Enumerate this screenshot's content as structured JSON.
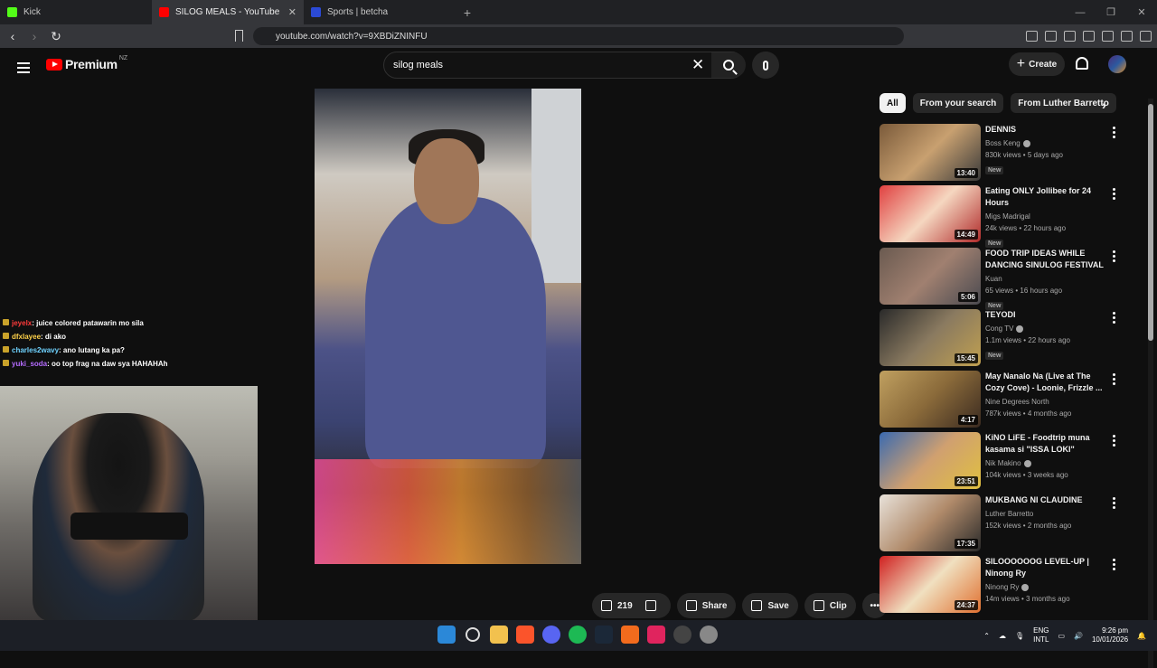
{
  "browser": {
    "tabs": [
      {
        "title": "Kick",
        "color": "#53fc18"
      },
      {
        "title": "SILOG MEALS - YouTube",
        "color": "#ff0000"
      },
      {
        "title": "Sports | betcha",
        "color": "#2b4ad6"
      }
    ],
    "url": "youtube.com/watch?v=9XBDiZNINFU"
  },
  "youtube": {
    "logo_text": "Premium",
    "region": "NZ",
    "search_query": "silog meals",
    "create_label": "Create",
    "filter_chips": [
      "All",
      "From your search",
      "From Luther Barretto"
    ],
    "actions": {
      "likes": "219",
      "share": "Share",
      "save": "Save",
      "clip": "Clip"
    },
    "recommendations": [
      {
        "title": "DENNIS",
        "channel": "Boss Keng",
        "verified": true,
        "meta": "830k views • 5 days ago",
        "badge": "New",
        "duration": "13:40",
        "thumb": [
          "#7a5a3a",
          "#c8a070",
          "#3a3a3a"
        ]
      },
      {
        "title": "Eating ONLY Jollibee for 24 Hours",
        "channel": "Migs Madrigal",
        "verified": false,
        "meta": "24k views • 22 hours ago",
        "badge": "New",
        "duration": "14:49",
        "thumb": [
          "#e04040",
          "#f5d7c0",
          "#b02a2a"
        ]
      },
      {
        "title": "FOOD TRIP IDEAS WHILE DANCING SINULOG FESTIVAL ...",
        "channel": "Kuan",
        "verified": false,
        "meta": "65 views • 16 hours ago",
        "badge": "New",
        "duration": "5:06",
        "thumb": [
          "#6a5a50",
          "#a08070",
          "#4a4a50"
        ]
      },
      {
        "title": "TEYODI",
        "channel": "Cong TV",
        "verified": true,
        "meta": "1.1m views • 22 hours ago",
        "badge": "New",
        "duration": "15:45",
        "thumb": [
          "#2a2a2a",
          "#8a7a60",
          "#c0a050"
        ]
      },
      {
        "title": "May Nanalo Na (Live at The Cozy Cove) - Loonie, Frizzle ...",
        "channel": "Nine Degrees North",
        "verified": false,
        "meta": "787k views • 4 months ago",
        "badge": "",
        "duration": "4:17",
        "thumb": [
          "#c0a060",
          "#8a6a3a",
          "#3a2a20"
        ]
      },
      {
        "title": "KiNO LiFE - Foodtrip muna kasama si \"ISSA LOKI\"",
        "channel": "Nik Makino",
        "verified": true,
        "meta": "104k views • 3 weeks ago",
        "badge": "",
        "duration": "23:51",
        "thumb": [
          "#3a6ab0",
          "#d0a070",
          "#e0c040"
        ]
      },
      {
        "title": "MUKBANG NI CLAUDINE",
        "channel": "Luther Barretto",
        "verified": false,
        "meta": "152k views • 2 months ago",
        "badge": "",
        "duration": "17:35",
        "thumb": [
          "#e8e2da",
          "#b08a6a",
          "#2a2a2a"
        ]
      },
      {
        "title": "SILOOOOOOG LEVEL-UP | Ninong Ry",
        "channel": "Ninong Ry",
        "verified": true,
        "meta": "14m views • 3 months ago",
        "badge": "",
        "duration": "24:37",
        "thumb": [
          "#d02020",
          "#f0e0c0",
          "#e07030"
        ]
      }
    ]
  },
  "chat": [
    {
      "user": "jeyelx",
      "user_color": "#ff3b3b",
      "message": ": juice colored patawarin mo sila"
    },
    {
      "user": "dfxlayee",
      "user_color": "#ffd24a",
      "message": ": di ako"
    },
    {
      "user": "charles2wavy",
      "user_color": "#6fd3ff",
      "message": ": ano lutang ka pa?"
    },
    {
      "user": "yuki_soda",
      "user_color": "#b56cff",
      "message": ": oo top frag na daw sya HAHAHAh"
    }
  ],
  "taskbar": {
    "lang_line1": "ENG",
    "lang_line2": "INTL",
    "time": "9:26 pm",
    "date": "10/01/2026"
  }
}
